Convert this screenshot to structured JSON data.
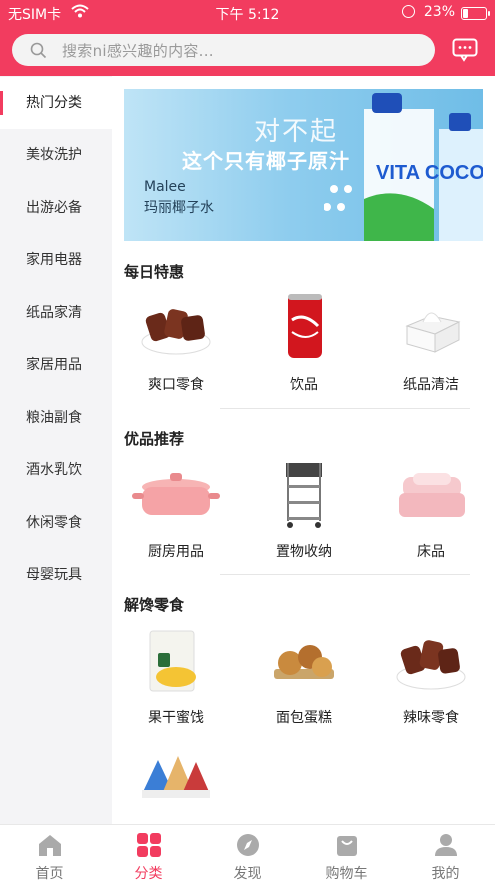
{
  "status_bar": {
    "carrier": "无SIM卡",
    "time": "下午 5:12",
    "battery": "23%",
    "battery_level": 0.23
  },
  "search": {
    "placeholder": "搜索ni感兴趣的内容..."
  },
  "sidebar": {
    "items": [
      {
        "label": "热门分类",
        "active": true
      },
      {
        "label": "美妆洗护"
      },
      {
        "label": "出游必备"
      },
      {
        "label": "家用电器"
      },
      {
        "label": "纸品家清"
      },
      {
        "label": "家居用品"
      },
      {
        "label": "粮油副食"
      },
      {
        "label": "酒水乳饮"
      },
      {
        "label": "休闲零食"
      },
      {
        "label": "母婴玩具"
      }
    ]
  },
  "banner": {
    "line1": "对不起",
    "line2": "这个只有椰子原汁",
    "brand_en": "Malee",
    "brand_cn": "玛丽椰子水",
    "product_text": "VITA COCO"
  },
  "sections": [
    {
      "title": "每日特惠",
      "items": [
        {
          "label": "爽口零食",
          "icon": "jerky-snack-icon"
        },
        {
          "label": "饮品",
          "icon": "cola-can-icon"
        },
        {
          "label": "纸品清洁",
          "icon": "tissue-box-icon"
        }
      ]
    },
    {
      "title": "优品推荐",
      "items": [
        {
          "label": "厨房用品",
          "icon": "casserole-pot-icon"
        },
        {
          "label": "置物收纳",
          "icon": "storage-cart-icon"
        },
        {
          "label": "床品",
          "icon": "bedding-icon"
        }
      ]
    },
    {
      "title": "解馋零食",
      "items": [
        {
          "label": "果干蜜饯",
          "icon": "dried-fruit-icon"
        },
        {
          "label": "面包蛋糕",
          "icon": "bread-cake-icon"
        },
        {
          "label": "辣味零食",
          "icon": "spicy-snack-icon"
        },
        {
          "label": "",
          "icon": "snack-bags-icon"
        }
      ]
    }
  ],
  "tabbar": {
    "items": [
      {
        "label": "首页",
        "icon": "home-icon"
      },
      {
        "label": "分类",
        "icon": "category-icon",
        "active": true
      },
      {
        "label": "发现",
        "icon": "compass-icon"
      },
      {
        "label": "购物车",
        "icon": "cart-icon"
      },
      {
        "label": "我的",
        "icon": "user-icon"
      }
    ]
  },
  "colors": {
    "accent": "#f23c5f",
    "sidebar_bg": "#f4f4f6"
  }
}
